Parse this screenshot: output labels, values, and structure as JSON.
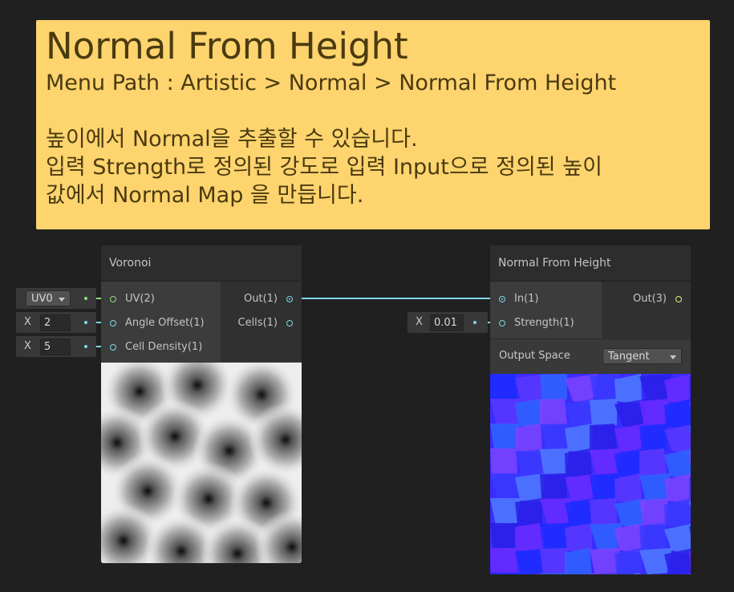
{
  "note": {
    "title": "Normal From Height",
    "path": "Menu Path : Artistic > Normal > Normal From Height",
    "description": "높이에서 Normal을 추출할 수 있습니다.\n입력 Strength로 정의된 강도로 입력 Input으로 정의된 높이\n값에서 Normal Map 을 만듭니다."
  },
  "voronoi": {
    "title": "Voronoi",
    "inputs": [
      {
        "label": "UV(2)"
      },
      {
        "label": "Angle Offset(1)"
      },
      {
        "label": "Cell Density(1)"
      }
    ],
    "outputs": [
      {
        "label": "Out(1)"
      },
      {
        "label": "Cells(1)"
      }
    ],
    "uv_field": "UV0",
    "angle_offset_label": "X",
    "angle_offset_value": "2",
    "cell_density_label": "X",
    "cell_density_value": "5"
  },
  "normal_node": {
    "title": "Normal From Height",
    "inputs": [
      {
        "label": "In(1)"
      },
      {
        "label": "Strength(1)"
      }
    ],
    "outputs": [
      {
        "label": "Out(3)"
      }
    ],
    "strength_label": "X",
    "strength_value": "0.01",
    "output_space_label": "Output Space",
    "output_space_value": "Tangent"
  },
  "colors": {
    "note_bg": "#fdd46e",
    "wire_cyan": "#7fd6e8",
    "wire_green": "#8be07b"
  }
}
